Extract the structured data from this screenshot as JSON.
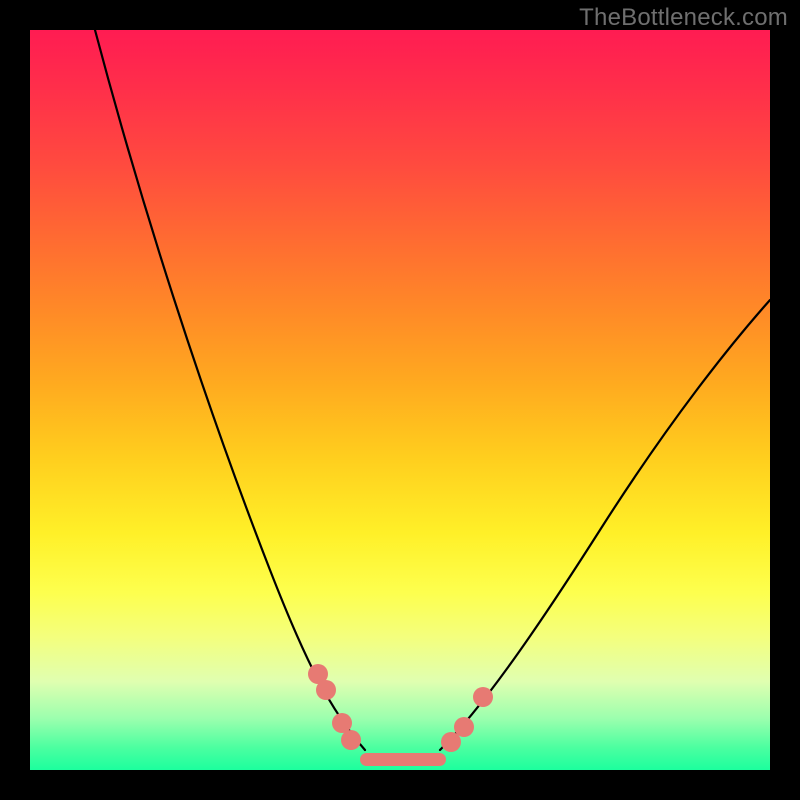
{
  "watermark": "TheBottleneck.com",
  "colors": {
    "marker": "#e77a73",
    "line": "#000000",
    "background_top": "#ff1c52",
    "background_bottom": "#1cff9e"
  },
  "chart_data": {
    "type": "line",
    "title": "",
    "xlabel": "",
    "ylabel": "",
    "xlim": [
      0,
      100
    ],
    "ylim": [
      0,
      100
    ],
    "series": [
      {
        "name": "left-arm",
        "x": [
          9,
          12,
          15,
          18,
          21,
          24,
          27,
          30,
          33,
          36,
          39,
          41,
          43,
          45,
          47
        ],
        "y": [
          100,
          90,
          80,
          70,
          60,
          50,
          41,
          33,
          26,
          19,
          12,
          8,
          5,
          2,
          1
        ]
      },
      {
        "name": "right-arm",
        "x": [
          55,
          57,
          60,
          64,
          70,
          78,
          88,
          100
        ],
        "y": [
          1,
          3,
          7,
          14,
          24,
          37,
          50,
          63
        ]
      }
    ],
    "flat_segment": {
      "x_start": 45,
      "x_end": 56,
      "y": 0.8
    },
    "markers": [
      {
        "x": 39.0,
        "y": 12.5,
        "r": 1.3
      },
      {
        "x": 40.5,
        "y": 10.0,
        "r": 1.3
      },
      {
        "x": 42.0,
        "y": 6.0,
        "r": 1.3
      },
      {
        "x": 43.5,
        "y": 3.5,
        "r": 1.3
      },
      {
        "x": 56.5,
        "y": 2.5,
        "r": 1.3
      },
      {
        "x": 58.5,
        "y": 5.0,
        "r": 1.3
      },
      {
        "x": 61.0,
        "y": 9.5,
        "r": 1.3
      }
    ]
  }
}
